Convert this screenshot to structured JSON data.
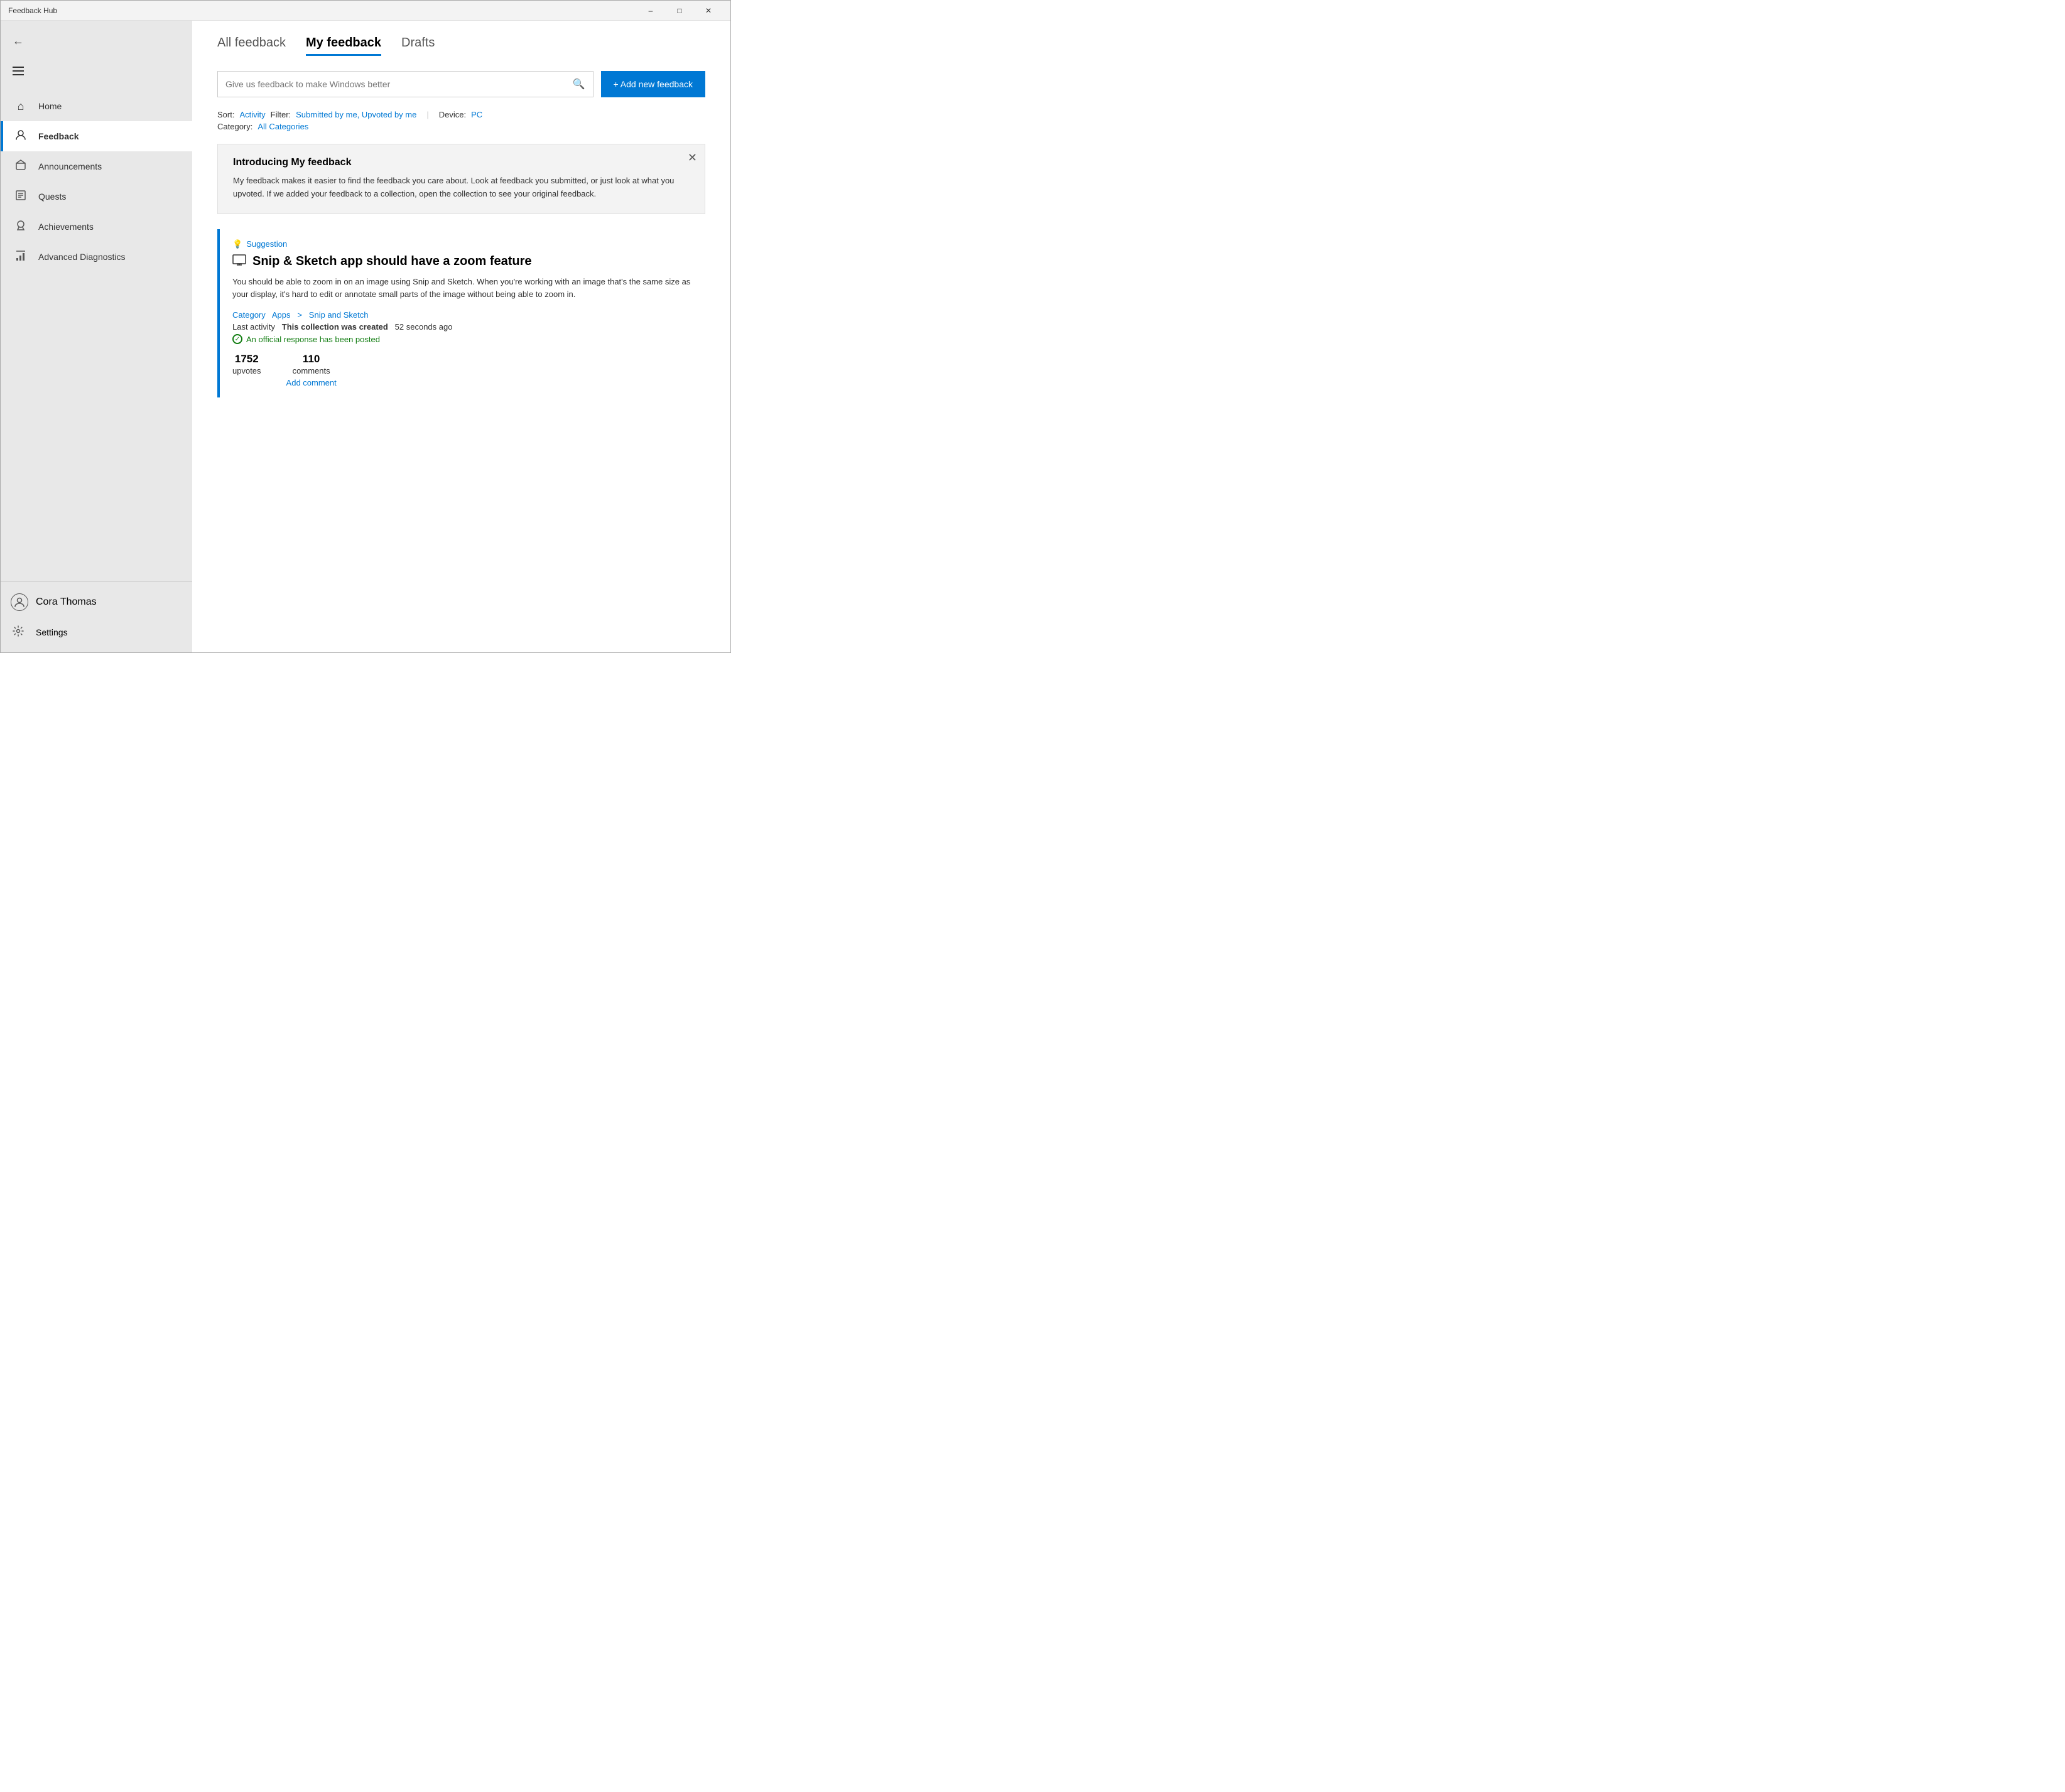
{
  "titleBar": {
    "title": "Feedback Hub",
    "minimizeLabel": "–",
    "maximizeLabel": "□",
    "closeLabel": "✕"
  },
  "sidebar": {
    "backArrow": "←",
    "hamburgerAria": "Menu",
    "navItems": [
      {
        "id": "home",
        "icon": "⌂",
        "label": "Home",
        "active": false
      },
      {
        "id": "feedback",
        "icon": "👤",
        "label": "Feedback",
        "active": true
      },
      {
        "id": "announcements",
        "icon": "📢",
        "label": "Announcements",
        "active": false
      },
      {
        "id": "quests",
        "icon": "📋",
        "label": "Quests",
        "active": false
      },
      {
        "id": "achievements",
        "icon": "🏆",
        "label": "Achievements",
        "active": false
      },
      {
        "id": "advanced-diagnostics",
        "icon": "📊",
        "label": "Advanced Diagnostics",
        "active": false
      }
    ],
    "user": {
      "name": "Cora Thomas",
      "avatarIcon": "👤"
    },
    "settings": {
      "label": "Settings",
      "icon": "⚙"
    }
  },
  "tabs": [
    {
      "id": "all-feedback",
      "label": "All feedback",
      "active": false
    },
    {
      "id": "my-feedback",
      "label": "My feedback",
      "active": true
    },
    {
      "id": "drafts",
      "label": "Drafts",
      "active": false
    }
  ],
  "search": {
    "placeholder": "Give us feedback to make Windows better",
    "iconAria": "search"
  },
  "addButton": {
    "label": "+ Add new feedback"
  },
  "filters": {
    "sortLabel": "Sort:",
    "sortValue": "Activity",
    "filterLabel": "Filter:",
    "filterValue": "Submitted by me, Upvoted by me",
    "deviceLabel": "Device:",
    "deviceValue": "PC"
  },
  "category": {
    "label": "Category:",
    "value": "All Categories"
  },
  "infoBox": {
    "title": "Introducing My feedback",
    "body": "My feedback makes it easier to find the feedback you care about. Look at feedback you submitted, or just look at what you upvoted. If we added your feedback to a collection, open the collection to see your original feedback.",
    "closeAria": "Close"
  },
  "feedbackItem": {
    "type": "Suggestion",
    "typeIcon": "💡",
    "titleIcon": "🖥",
    "title": "Snip & Sketch app should have a zoom feature",
    "body": "You should be able to zoom in on an image using Snip and Sketch. When you're working with an image that's the same size as your display, it's hard to edit or annotate small parts of the image without being able to zoom in.",
    "categoryLabel": "Category",
    "categoryApp": "Apps",
    "categorySeparator": ">",
    "categoryApp2": "Snip and Sketch",
    "activityLabel": "Last activity",
    "activityText": "This collection was created",
    "activityTime": "52 seconds ago",
    "responseText": "An official response has been posted",
    "upvotes": "1752",
    "upvotesLabel": "upvotes",
    "comments": "110",
    "commentsLabel": "comments",
    "addCommentLabel": "Add comment"
  }
}
